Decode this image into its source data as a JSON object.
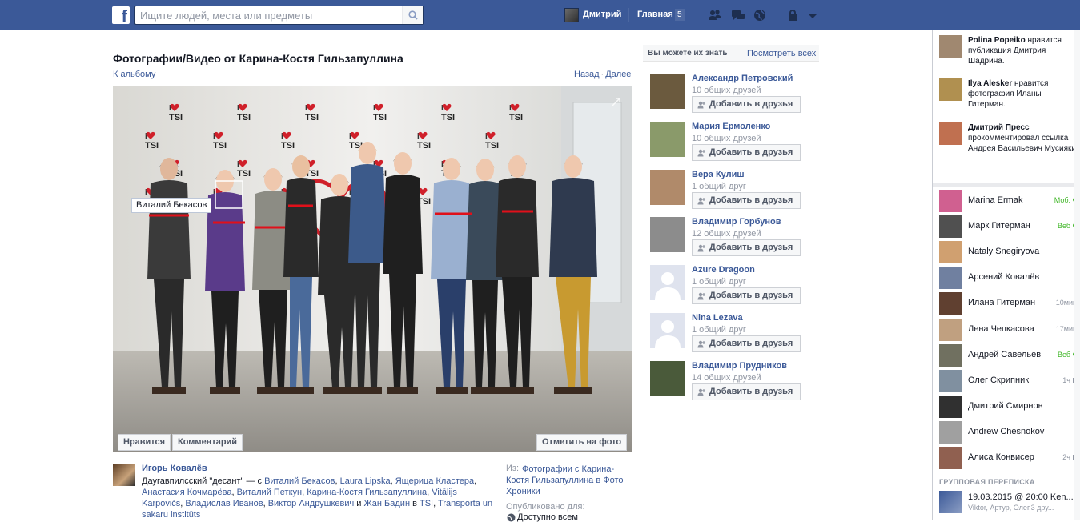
{
  "topbar": {
    "logo": "f",
    "search_placeholder": "Ищите людей, места или предметы",
    "profile_name": "Дмитрий",
    "home_label": "Главная",
    "home_count": "5"
  },
  "photo_page": {
    "title": "Фотографии/Видео от Карина-Костя Гильзапуллина",
    "album_link": "К альбому",
    "prev_link": "Назад",
    "pager_sep": "·",
    "next_link": "Далее",
    "tag_label": "Виталий Бекасов",
    "like_button": "Нравится",
    "comment_button": "Комментарий",
    "tag_photo_button": "Отметить на фото",
    "backdrop_text": "TSI"
  },
  "caption": {
    "author": "Игорь Ковалёв",
    "text_start": "Даугавпилсский \"десант\"",
    "with_word": " — с ",
    "tagged": [
      "Виталий Бекасов",
      "Laura Lipska",
      "Ящерица Кластера",
      "Анастасия Кочмарёва",
      "Виталий Петкун",
      "Карина-Костя Гильзапуллина",
      "Vitālijs Karpovičs",
      "Владислав Иванов",
      "Виктор Андрушкевич"
    ],
    "and_word": " и ",
    "last_tagged": "Жан Бадин",
    "in_word": " в ",
    "places": [
      "TSI",
      "Transporta un sakaru institūts"
    ],
    "from_label": "Из:",
    "from_link": "Фотографии с Карина-Костя Гильзапуллина в Фото Хроники",
    "published_label": "Опубликовано для:",
    "privacy_value": "Доступно всем"
  },
  "pymk": {
    "title": "Вы можете их знать",
    "see_all": "Посмотреть всех",
    "add_label": "Добавить в друзья",
    "people": [
      {
        "name": "Александр Петровский",
        "mutual": "10 общих друзей",
        "photo_color": "#6b5a3e"
      },
      {
        "name": "Мария Ермоленко",
        "mutual": "10 общих друзей",
        "photo_color": "#8a9a6a"
      },
      {
        "name": "Вера Кулиш",
        "mutual": "1 общий друг",
        "photo_color": "#b08a6a"
      },
      {
        "name": "Владимир Горбунов",
        "mutual": "12 общих друзей",
        "photo_color": "#8c8c8c"
      },
      {
        "name": "Azure Dragoon",
        "mutual": "1 общий друг",
        "photo_color": "#dfe3ee"
      },
      {
        "name": "Nina Lezava",
        "mutual": "1 общий друг",
        "photo_color": "#dfe3ee"
      },
      {
        "name": "Владимир Прудников",
        "mutual": "14 общих друзей",
        "photo_color": "#4a5a3a"
      }
    ]
  },
  "ticker": [
    {
      "actor": "Polina Popeiko",
      "text": " нравится публикация Дмитрия Шадрина.",
      "photo_color": "#a08870"
    },
    {
      "actor": "Ilya Alesker",
      "text": " нравится фотография Иланы Гитерман.",
      "photo_color": "#b09050"
    },
    {
      "actor": "Дмитрий Пресс",
      "text": " прокомментировал ссылка Андрея Васильевич Мусияки.",
      "photo_color": "#c07050"
    }
  ],
  "chat": {
    "friends": [
      {
        "name": "Marina Ermak",
        "status": "Моб.",
        "status_type": "mobile",
        "photo_color": "#d06090"
      },
      {
        "name": "Марк Гитерман",
        "status": "Веб",
        "status_type": "web",
        "photo_color": "#505050"
      },
      {
        "name": "Nataly Snegiryova",
        "status": "",
        "status_type": "none",
        "photo_color": "#d0a070"
      },
      {
        "name": "Арсений Ковалёв",
        "status": "",
        "status_type": "none",
        "photo_color": "#7080a0"
      },
      {
        "name": "Илана Гитерман",
        "status": "10мин",
        "status_type": "idle",
        "photo_color": "#604030"
      },
      {
        "name": "Лена Чепкасова",
        "status": "17мин",
        "status_type": "idle",
        "photo_color": "#c0a080"
      },
      {
        "name": "Андрей Савельев",
        "status": "Веб",
        "status_type": "web",
        "photo_color": "#707060"
      },
      {
        "name": "Олег Скрипник",
        "status": "1ч",
        "status_type": "mobile-idle",
        "photo_color": "#8090a0"
      },
      {
        "name": "Дмитрий Смирнов",
        "status": "",
        "status_type": "none",
        "photo_color": "#303030"
      },
      {
        "name": "Andrew Chesnokov",
        "status": "",
        "status_type": "none",
        "photo_color": "#a0a0a0"
      },
      {
        "name": "Алиса Конвисер",
        "status": "2ч",
        "status_type": "mobile-idle",
        "photo_color": "#906050"
      }
    ],
    "group_header": "ГРУППОВАЯ ПЕРЕПИСКА",
    "group_name": "19.03.2015 @ 20:00 Ken...",
    "group_members": "Viktor, Артур, Олег,3 дру..."
  }
}
